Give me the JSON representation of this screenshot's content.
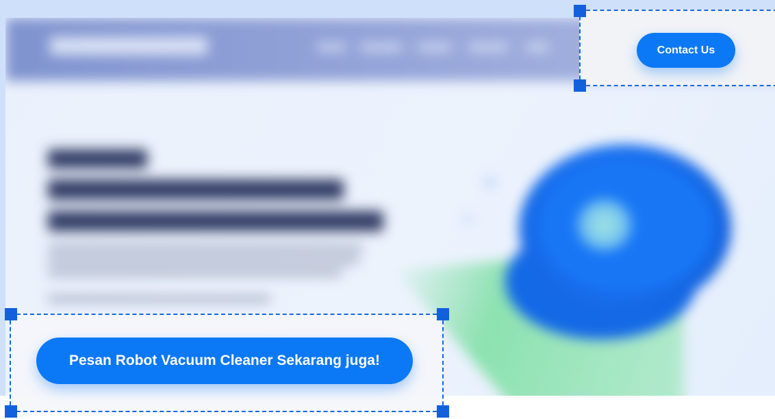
{
  "header": {
    "contact_button_label": "Contact Us"
  },
  "hero": {
    "cta_label": "Pesan Robot Vacuum Cleaner Sekarang juga!"
  },
  "colors": {
    "accent": "#0b78f6",
    "selection": "#1467e0",
    "background_tint": "#cfe0fb"
  },
  "icons": {
    "selection_handle": "square-handle-icon"
  }
}
